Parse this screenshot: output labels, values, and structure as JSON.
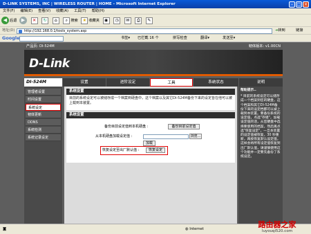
{
  "window": {
    "title": "D-LINK SYSTEMS, INC | WIRELESS ROUTER | HOME - Microsoft Internet Explorer"
  },
  "menu": [
    "文件(F)",
    "编辑(E)",
    "查看(V)",
    "收藏(A)",
    "工具(T)",
    "帮助(H)"
  ],
  "toolbar": {
    "back": "后退",
    "search": "搜索",
    "favorites": "收藏夹"
  },
  "address": {
    "label": "地址(D)",
    "url": "http://192.168.0.1/tools_system.asp",
    "go": "转到",
    "links": "链接"
  },
  "googlebar": {
    "logo": "Google",
    "bookmarks": "书签▾",
    "blocked": "已拦截 16 个",
    "spell": "拼写检查",
    "translate": "翻译▾",
    "send": "发送至▾"
  },
  "router": {
    "product_label": "产品页: DI-524M",
    "firmware": "韧体版本: v1.00CN",
    "logo": "D-Link",
    "model": "DI-524M",
    "tabs": [
      "设置",
      "进阶设定",
      "工具",
      "系统状态",
      "说明"
    ],
    "leftnav": [
      "管理者设置",
      "时间设置",
      "系统设定",
      "韧体更新",
      "DDNS",
      "系统检测",
      "系统记录设定"
    ],
    "section1_title": "系统设置",
    "section1_text": "目前的系统设定可以被储存成一个档案到硬盘中，这个档案以及其它DI-524M备份下来的设定皆在他可以被上载到本装置。",
    "section2_title": "系统设置",
    "save_label": "备份目前设定值到本机硬盘 :",
    "save_button": "备份目前设定值",
    "load_label": "从本机硬盘加载设定值 :",
    "browse_button": "浏览...",
    "load_button": "加载",
    "restore_label": "恢复设定至出厂默认值 :",
    "restore_button": "恢复设定",
    "help_title": "帮助提示..",
    "help_text": "* 目前的系统设定可以储存成一个档案到您的硬盘，这个档案和其它DI-524M备份下来的设定档都可以被上载到本装置。要备份系统的设定值，点选\"存储\"，加载设定值的话，从您硬盘中选择要使用的档案，然后再点选\"恢复设定\"，一旦本装置的设定值被恢复，30 秒重新，再按恢复默认设定值，这样会将所有设定值恢复到出厂默认值，请谨慎使用这个功能并一定要先备份了系统设定。"
  },
  "status": {
    "zone": "Internet"
  },
  "watermark": {
    "name": "路由器之家",
    "url": "luyouqi520.com"
  }
}
